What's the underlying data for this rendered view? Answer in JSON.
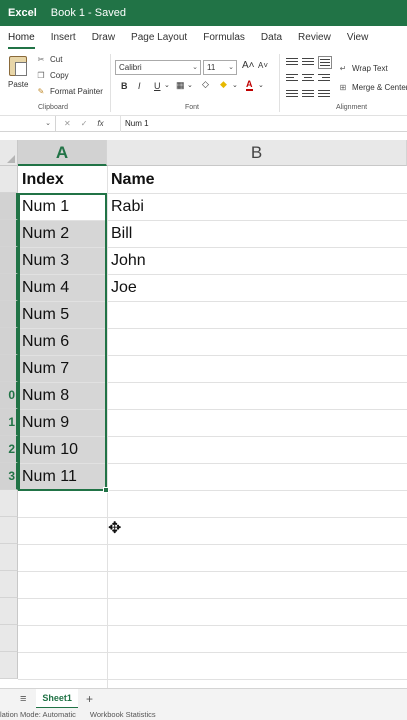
{
  "titlebar": {
    "app": "Excel",
    "doc": "Book 1 - Saved"
  },
  "tabs": [
    "Home",
    "Insert",
    "Draw",
    "Page Layout",
    "Formulas",
    "Data",
    "Review",
    "View"
  ],
  "ribbon": {
    "paste": "Paste",
    "cut": "Cut",
    "copy": "Copy",
    "format_painter": "Format Painter",
    "clipboard": "Clipboard",
    "font_name": "Calibri",
    "font_size": "11",
    "bold": "B",
    "italic": "I",
    "underline": "U",
    "font_label": "Font",
    "wrap_text": "Wrap Text",
    "merge_center": "Merge & Center",
    "alignment": "Alignment",
    "grow_font": "A",
    "shrink_font": "A",
    "font_color_letter": "A"
  },
  "formula_bar": {
    "fx": "fx",
    "value": "Num 1"
  },
  "columns": {
    "a": "A",
    "b": "B"
  },
  "rows": [
    "",
    "",
    "",
    "",
    "",
    "",
    "",
    "",
    "0",
    "1",
    "2",
    "3",
    "",
    "",
    "",
    "",
    "",
    "",
    ""
  ],
  "table": {
    "header": [
      "Index",
      "Name"
    ],
    "index": [
      "Num 1",
      "Num 2",
      "Num 3",
      "Num 4",
      "Num 5",
      "Num 6",
      "Num 7",
      "Num 8",
      "Num 9",
      "Num 10",
      "Num 11"
    ],
    "names": [
      "Rabi",
      "Bill",
      "John",
      "Joe"
    ]
  },
  "sheets": {
    "menu": "≡",
    "active": "Sheet1",
    "add": "+"
  },
  "status": {
    "calc": "lation Mode: Automatic",
    "stats": "Workbook Statistics"
  },
  "colors": {
    "accent": "#217346",
    "selection": "#d6d6d6"
  }
}
